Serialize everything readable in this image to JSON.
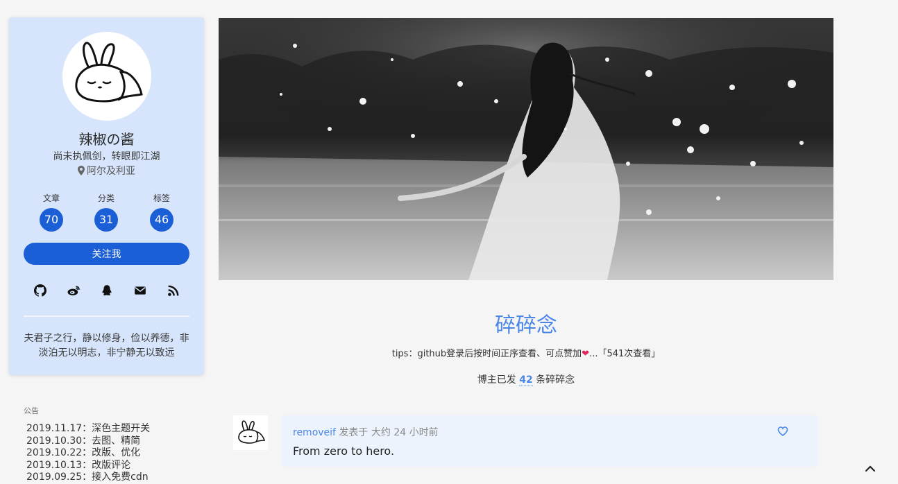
{
  "sidebar": {
    "author_name": "辣椒の酱",
    "motto": "尚未执佩剑，转眼即江湖",
    "location": "阿尔及利亚",
    "stats": [
      {
        "label": "文章",
        "value": "70"
      },
      {
        "label": "分类",
        "value": "31"
      },
      {
        "label": "标签",
        "value": "46"
      }
    ],
    "follow_label": "关注我",
    "social_icons": [
      "github-icon",
      "weibo-icon",
      "qq-icon",
      "mail-icon",
      "rss-icon"
    ],
    "quote": "夫君子之行，静以修身，俭以养德，非淡泊无以明志，非宁静无以致远"
  },
  "announcement": {
    "title": "公告",
    "items": [
      "2019.11.17：深色主题开关",
      "2019.10.30：去图、精简",
      "2019.10.22：改版、优化",
      "2019.10.13：改版评论",
      "2019.09.25：接入免费cdn"
    ]
  },
  "page": {
    "title": "碎碎念",
    "tips_before": "tips：github登录后按时间正序查看、可点赞加",
    "tips_after": "...「541次查看」",
    "count_before": "博主已发",
    "count_value": "42",
    "count_after": "条碎碎念"
  },
  "post": {
    "author": "removeif",
    "published_label": "发表于",
    "time": "大约 24 小时前",
    "content": "From zero to hero."
  },
  "colors": {
    "accent": "#1b5fd7",
    "link": "#4a86e8",
    "card_bg": "#d6e5fb",
    "post_bg": "#edf3fc"
  }
}
